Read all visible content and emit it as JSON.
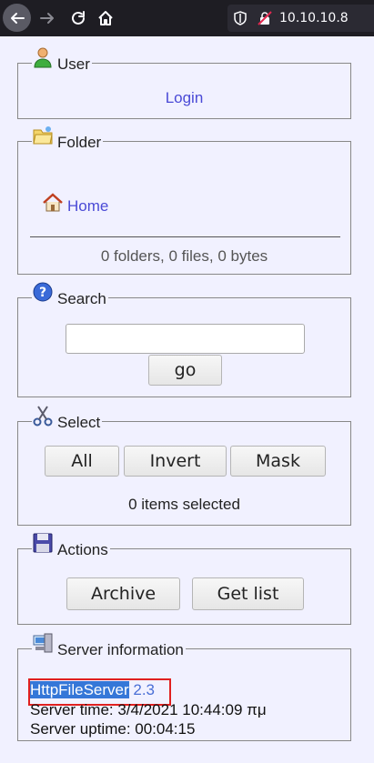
{
  "browser": {
    "url": "10.10.10.8",
    "icons": [
      "back-arrow-icon",
      "forward-arrow-icon",
      "reload-icon",
      "home-icon",
      "shield-icon",
      "insecure-lock-icon"
    ]
  },
  "user": {
    "title": "User",
    "login_label": "Login",
    "icon": "user-icon"
  },
  "folder": {
    "title": "Folder",
    "home_label": "Home",
    "stats": "0 folders, 0 files, 0 bytes",
    "icon": "folder-icon",
    "home_icon": "home-icon"
  },
  "search": {
    "title": "Search",
    "input_value": "",
    "go_label": "go",
    "icon": "help-icon"
  },
  "select": {
    "title": "Select",
    "all_label": "All",
    "invert_label": "Invert",
    "mask_label": "Mask",
    "status": "0 items selected",
    "icon": "scissors-icon"
  },
  "actions": {
    "title": "Actions",
    "archive_label": "Archive",
    "getlist_label": "Get list",
    "icon": "floppy-disk-icon"
  },
  "server": {
    "title": "Server information",
    "product": "HttpFileServer",
    "version": "2.3",
    "time_line": "Server time: 3/4/2021 10:44:09 πμ",
    "uptime_line": "Server uptime: 00:04:15",
    "icon": "server-icon",
    "highlight_color": "#e02020"
  }
}
